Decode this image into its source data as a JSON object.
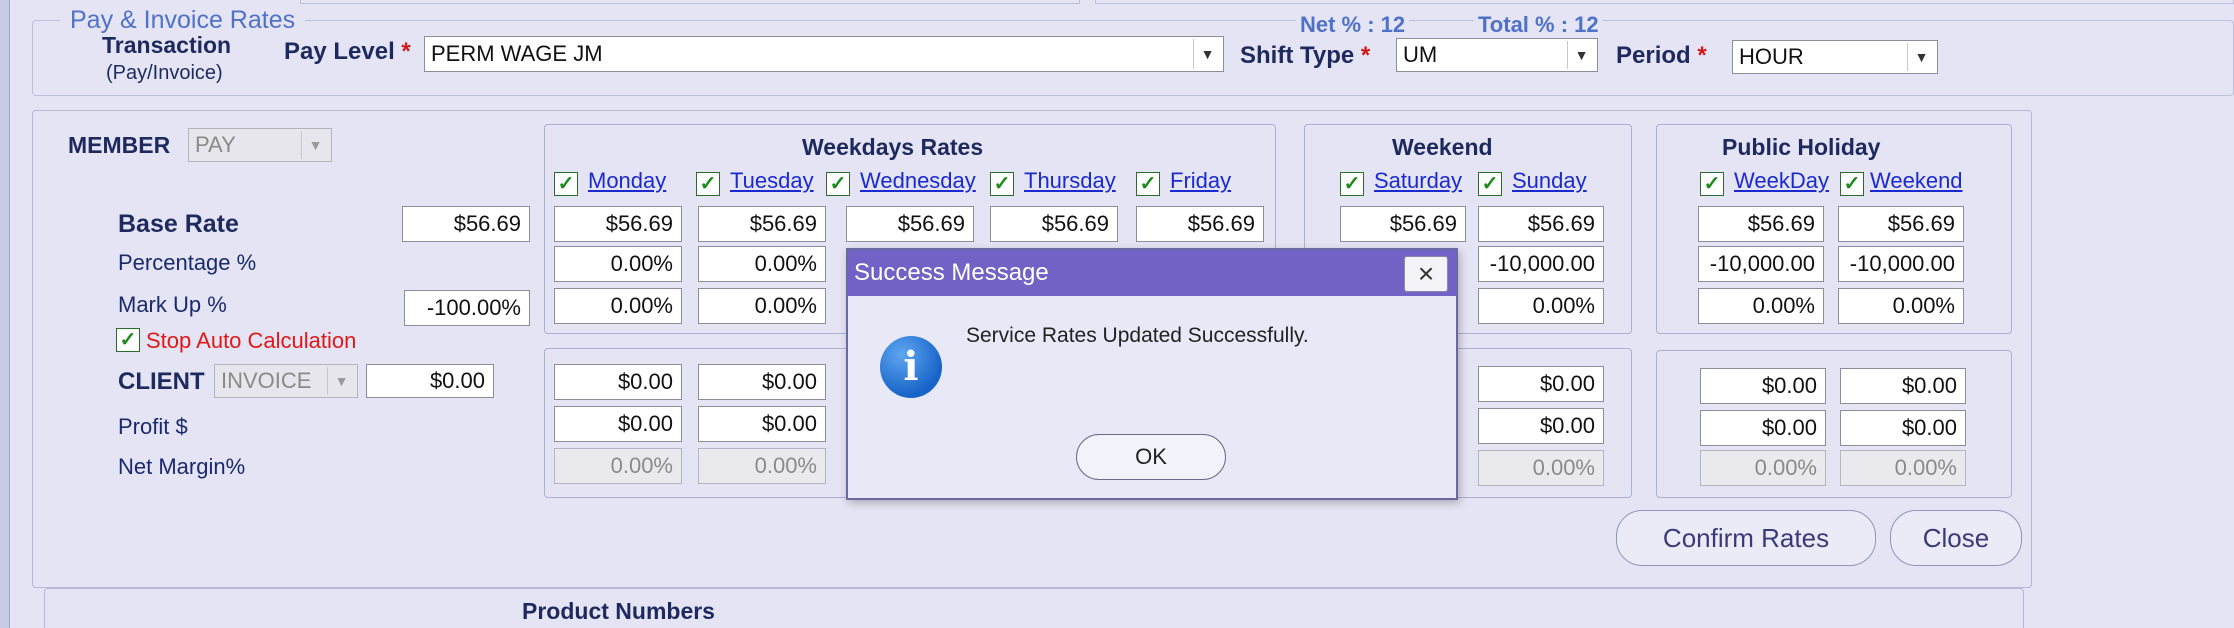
{
  "section_title": "Pay & Invoice Rates",
  "transaction": {
    "label": "Transaction",
    "sub": "(Pay/Invoice)"
  },
  "pay_level": {
    "label": "Pay Level",
    "value": "PERM WAGE JM"
  },
  "net_pct": "Net % : 12",
  "total_pct": "Total % : 12",
  "shift_type": {
    "label": "Shift Type",
    "value": "UM"
  },
  "period": {
    "label": "Period",
    "value": "HOUR"
  },
  "member": {
    "label": "MEMBER",
    "select": "PAY"
  },
  "rows": {
    "base_rate": {
      "label": "Base Rate",
      "value": "$56.69"
    },
    "percentage": {
      "label": "Percentage %"
    },
    "mark_up": {
      "label": "Mark Up %",
      "value": "-100.00%"
    },
    "stop_auto": "Stop Auto Calculation",
    "client": {
      "label": "CLIENT",
      "select": "INVOICE",
      "value": "$0.00"
    },
    "profit": {
      "label": "Profit $"
    },
    "net_margin": {
      "label": "Net Margin%"
    }
  },
  "weekdays": {
    "title": "Weekdays Rates",
    "days": [
      "Monday",
      "Tuesday",
      "Wednesday",
      "Thursday",
      "Friday"
    ],
    "base": [
      "$56.69",
      "$56.69",
      "$56.69",
      "$56.69",
      "$56.69"
    ],
    "pct": [
      "0.00%",
      "0.00%"
    ],
    "markup": [
      "0.00%",
      "0.00%"
    ],
    "client": [
      "$0.00",
      "$0.00"
    ],
    "profit": [
      "$0.00",
      "$0.00"
    ],
    "margin": [
      "0.00%",
      "0.00%"
    ]
  },
  "weekend": {
    "title": "Weekend",
    "days": [
      "Saturday",
      "Sunday"
    ],
    "base": [
      "$56.69",
      "$56.69"
    ],
    "pct": [
      "-10,000.00"
    ],
    "markup": [
      "0.00%"
    ],
    "client": [
      "$0.00"
    ],
    "profit": [
      "$0.00"
    ],
    "margin": [
      "0.00%"
    ]
  },
  "holiday": {
    "title": "Public Holiday",
    "days": [
      "WeekDay",
      "Weekend"
    ],
    "base": [
      "$56.69",
      "$56.69"
    ],
    "pct": [
      "-10,000.00",
      "-10,000.00"
    ],
    "markup": [
      "0.00%",
      "0.00%"
    ],
    "client": [
      "$0.00",
      "$0.00"
    ],
    "profit": [
      "$0.00",
      "$0.00"
    ],
    "margin": [
      "0.00%",
      "0.00%"
    ]
  },
  "buttons": {
    "confirm": "Confirm Rates",
    "close": "Close"
  },
  "product_numbers": "Product Numbers",
  "dialog": {
    "title": "Success Message",
    "message": "Service Rates Updated Successfully.",
    "ok": "OK",
    "close_glyph": "×"
  },
  "glyphs": {
    "check": "✓",
    "dropdown": "▼",
    "info": "i"
  },
  "colors": {
    "background": "#e4e4f4",
    "dialog_title": "#7262c6",
    "required": "#d01818",
    "link": "#1a2ad0",
    "stop_auto": "#e01818"
  }
}
